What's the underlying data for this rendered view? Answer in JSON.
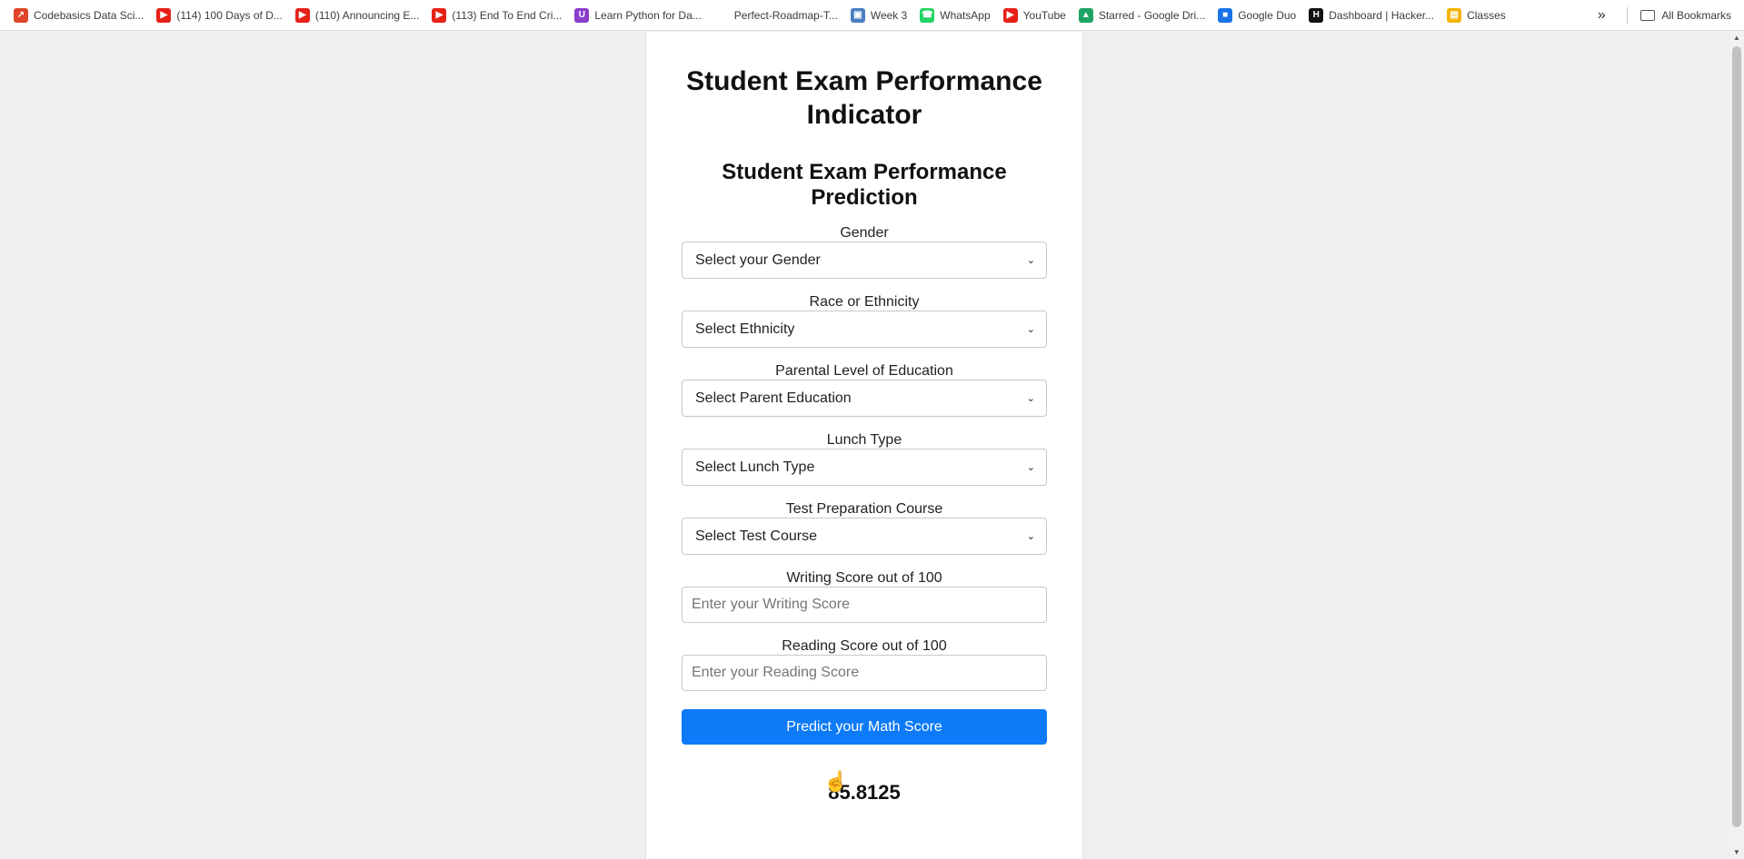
{
  "bookmarks": [
    {
      "label": "Codebasics Data Sci...",
      "icon": "rocket-icon",
      "color": "#e0442b"
    },
    {
      "label": "(114) 100 Days of D...",
      "icon": "youtube-icon",
      "color": "#e62117"
    },
    {
      "label": "(110) Announcing E...",
      "icon": "youtube-icon",
      "color": "#e62117"
    },
    {
      "label": "(113) End To End Cri...",
      "icon": "youtube-icon",
      "color": "#e62117"
    },
    {
      "label": "Learn Python for Da...",
      "icon": "udemy-icon",
      "color": "#8a3ec9"
    },
    {
      "label": "Perfect-Roadmap-T...",
      "icon": "blank-icon",
      "color": "#ffffff"
    },
    {
      "label": "Week 3",
      "icon": "robot-icon",
      "color": "#4a7fc1"
    },
    {
      "label": "WhatsApp",
      "icon": "whatsapp-icon",
      "color": "#25d366"
    },
    {
      "label": "YouTube",
      "icon": "youtube-icon",
      "color": "#e62117"
    },
    {
      "label": "Starred - Google Dri...",
      "icon": "drive-icon",
      "color": "#1fa463"
    },
    {
      "label": "Google Duo",
      "icon": "duo-icon",
      "color": "#1a73e8"
    },
    {
      "label": "Dashboard | Hacker...",
      "icon": "hackerrank-icon",
      "color": "#111111"
    },
    {
      "label": "Classes",
      "icon": "classroom-icon",
      "color": "#f5b400"
    }
  ],
  "bookmarks_more": "»",
  "all_bookmarks": "All Bookmarks",
  "page": {
    "title": "Student Exam Performance Indicator",
    "subtitle": "Student Exam Performance Prediction",
    "fields": {
      "gender": {
        "label": "Gender",
        "value": "Select your Gender"
      },
      "ethnicity": {
        "label": "Race or Ethnicity",
        "value": "Select Ethnicity"
      },
      "parent_education": {
        "label": "Parental Level of Education",
        "value": "Select Parent Education"
      },
      "lunch": {
        "label": "Lunch Type",
        "value": "Select Lunch Type"
      },
      "test_course": {
        "label": "Test Preparation Course",
        "value": "Select Test Course"
      },
      "writing": {
        "label": "Writing Score out of 100",
        "placeholder": "Enter your Writing Score"
      },
      "reading": {
        "label": "Reading Score out of 100",
        "placeholder": "Enter your Reading Score"
      }
    },
    "submit_label": "Predict your Math Score",
    "result": "85.8125"
  },
  "colors": {
    "accent": "#0d7bf7",
    "page_bg": "#efefef",
    "card_bg": "#ffffff"
  }
}
